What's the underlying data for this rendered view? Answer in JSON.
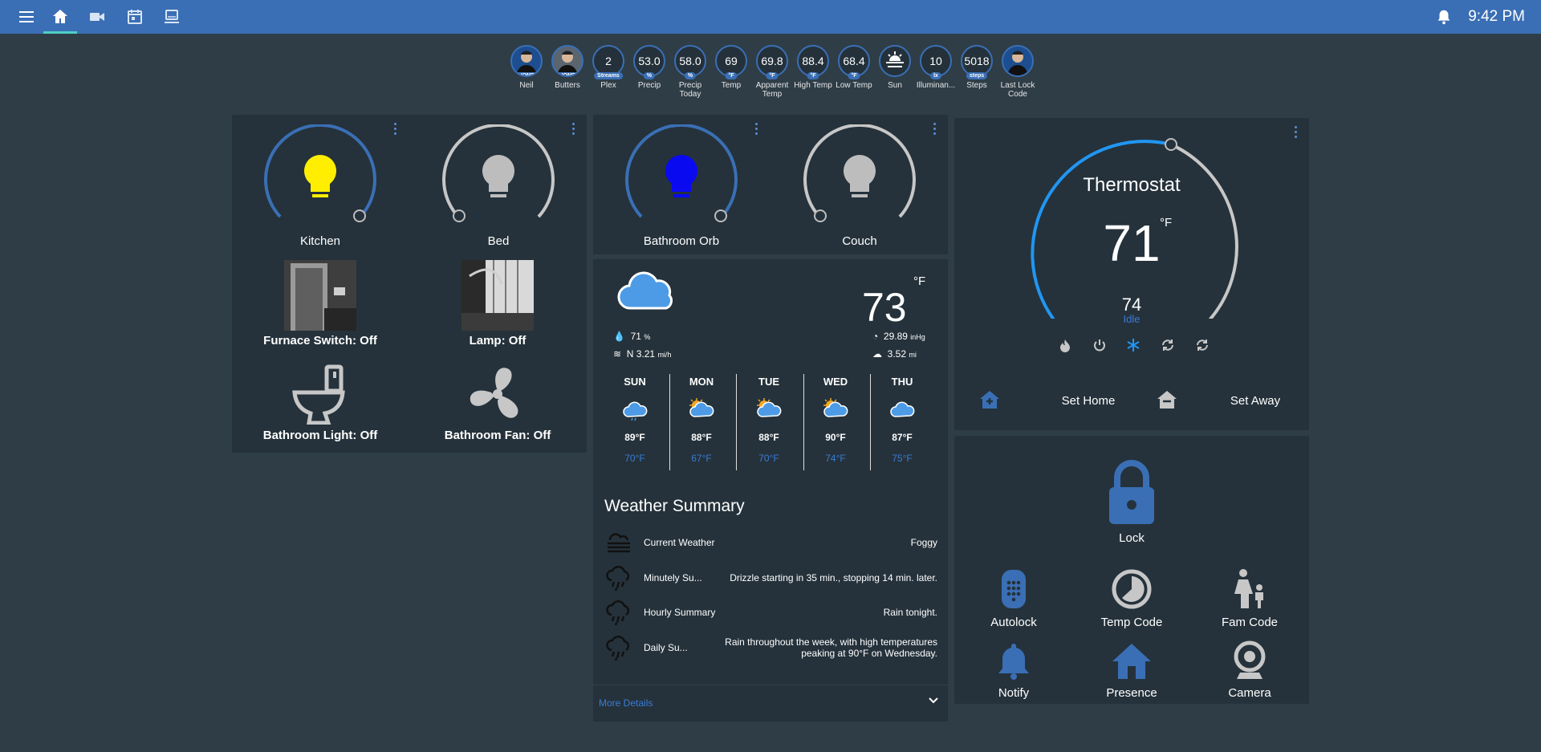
{
  "topbar": {
    "time": "9:42 PM",
    "icons": [
      "menu-icon",
      "home-icon",
      "video-icon",
      "calendar-icon",
      "laptop-icon",
      "bell-icon"
    ]
  },
  "badges": [
    {
      "value": "",
      "unit": "HOME",
      "label": "Neil",
      "kind": "photo"
    },
    {
      "value": "",
      "unit": "HOME",
      "label": "Butters",
      "kind": "photo2"
    },
    {
      "value": "2",
      "unit": "Streams",
      "label": "Plex"
    },
    {
      "value": "53.0",
      "unit": "%",
      "label": "Precip"
    },
    {
      "value": "58.0",
      "unit": "%",
      "label": "Precip Today"
    },
    {
      "value": "69",
      "unit": "°F",
      "label": "Temp"
    },
    {
      "value": "69.8",
      "unit": "°F",
      "label": "Apparent Temp"
    },
    {
      "value": "88.4",
      "unit": "°F",
      "label": "High Temp"
    },
    {
      "value": "68.4",
      "unit": "°F",
      "label": "Low Temp"
    },
    {
      "value": "",
      "unit": "",
      "label": "Sun",
      "kind": "sun"
    },
    {
      "value": "10",
      "unit": "lx",
      "label": "Illuminan..."
    },
    {
      "value": "5018",
      "unit": "steps",
      "label": "Steps"
    },
    {
      "value": "",
      "unit": "",
      "label": "Last Lock Code",
      "kind": "photo"
    }
  ],
  "lights_a": {
    "kitchen": {
      "name": "Kitchen",
      "color": "#ffee00",
      "level": 0.95
    },
    "bed": {
      "name": "Bed",
      "color": "#bdbdbd",
      "level": 0.0
    }
  },
  "entities_a": {
    "furnace": "Furnace Switch: Off",
    "lamp": "Lamp: Off",
    "bath_light": "Bathroom Light: Off",
    "bath_fan": "Bathroom Fan: Off"
  },
  "lights_b": {
    "orb": {
      "name": "Bathroom Orb",
      "color": "#0a0af0",
      "level": 0.95
    },
    "couch": {
      "name": "Couch",
      "color": "#bdbdbd",
      "level": 0.0
    }
  },
  "weather": {
    "temp": "73",
    "unit": "°F",
    "humidity": "71",
    "humidity_unit": "%",
    "wind": "N 3.21",
    "wind_unit": "mi/h",
    "pressure": "29.89",
    "pressure_unit": "inHg",
    "visibility": "3.52",
    "visibility_unit": "mi",
    "forecast": [
      {
        "day": "SUN",
        "hi": "89°F",
        "lo": "70°F",
        "icon": "rain-icon"
      },
      {
        "day": "MON",
        "hi": "88°F",
        "lo": "67°F",
        "icon": "partly-cloudy-icon"
      },
      {
        "day": "TUE",
        "hi": "88°F",
        "lo": "70°F",
        "icon": "partly-cloudy-icon"
      },
      {
        "day": "WED",
        "hi": "90°F",
        "lo": "74°F",
        "icon": "partly-cloudy-icon"
      },
      {
        "day": "THU",
        "hi": "87°F",
        "lo": "75°F",
        "icon": "cloud-icon"
      }
    ]
  },
  "summary": {
    "title": "Weather Summary",
    "rows": [
      {
        "key": "Current Weather",
        "value": "Foggy",
        "icon": "fog-icon"
      },
      {
        "key": "Minutely Su...",
        "value": "Drizzle starting in 35 min., stopping 14 min. later.",
        "icon": "rain-icon"
      },
      {
        "key": "Hourly Summary",
        "value": "Rain tonight.",
        "icon": "rain-icon"
      },
      {
        "key": "Daily Su...",
        "value": "Rain throughout the week, with high temperatures peaking at 90°F on Wednesday.",
        "icon": "rain-icon"
      }
    ],
    "more": "More Details"
  },
  "thermostat": {
    "title": "Thermostat",
    "setpoint": "71",
    "unit": "°F",
    "current": "74",
    "state": "Idle",
    "set_home": "Set Home",
    "set_away": "Set Away"
  },
  "controls": {
    "lock": "Lock",
    "autolock": "Autolock",
    "temp_code": "Temp Code",
    "fam_code": "Fam Code",
    "notify": "Notify",
    "presence": "Presence",
    "camera": "Camera"
  },
  "colors": {
    "accent": "#3a6fb5",
    "card": "#25323b",
    "background": "#2f3d47"
  }
}
